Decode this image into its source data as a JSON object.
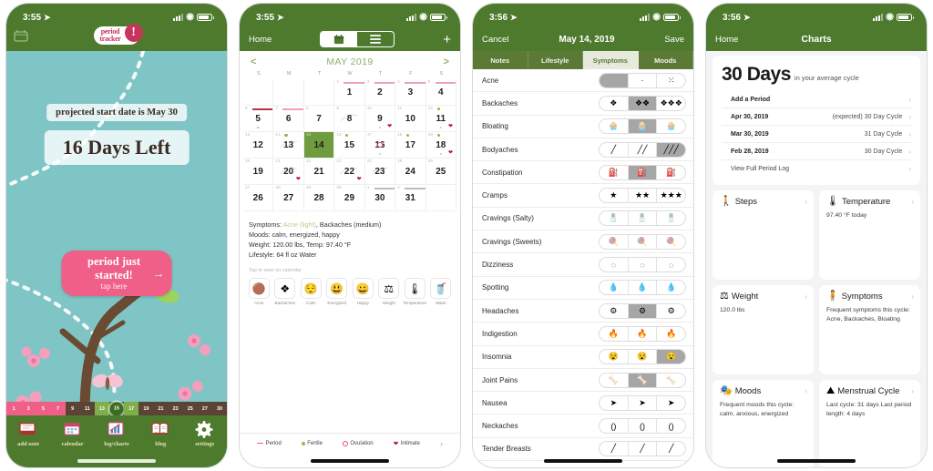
{
  "app": {
    "name": "Period Tracker",
    "brand_green": "#4e7a2e",
    "brand_pink": "#ef5f87",
    "brand_teal": "#7fc5c5",
    "brand_red": "#c8345c"
  },
  "panel1": {
    "status": {
      "time": "3:55",
      "location_icon": "location-arrow-icon"
    },
    "logo": {
      "line1": "period",
      "line2": "tracker",
      "bang": "!"
    },
    "projected_text": "projected start date is May 30",
    "days_left": "16 Days Left",
    "cta": {
      "title": "period just started!",
      "subtitle": "tap here",
      "arrow": "→"
    },
    "daystrip": [
      {
        "n": "1",
        "type": "period"
      },
      {
        "n": "3",
        "type": "period"
      },
      {
        "n": "5",
        "type": "period"
      },
      {
        "n": "7",
        "type": "period"
      },
      {
        "n": "9",
        "type": "normal"
      },
      {
        "n": "11",
        "type": "normal"
      },
      {
        "n": "13",
        "type": "fertile"
      },
      {
        "n": "15",
        "type": "today"
      },
      {
        "n": "17",
        "type": "fertile"
      },
      {
        "n": "19",
        "type": "normal"
      },
      {
        "n": "21",
        "type": "normal"
      },
      {
        "n": "23",
        "type": "normal"
      },
      {
        "n": "25",
        "type": "normal"
      },
      {
        "n": "27",
        "type": "normal"
      },
      {
        "n": "30",
        "type": "normal"
      }
    ],
    "tabs": [
      {
        "label": "add note",
        "icon": "note-icon"
      },
      {
        "label": "calendar",
        "icon": "calendar-icon"
      },
      {
        "label": "log/charts",
        "icon": "bar-chart-icon"
      },
      {
        "label": "blog",
        "icon": "book-icon"
      },
      {
        "label": "settings",
        "icon": "gear-icon"
      }
    ]
  },
  "panel2": {
    "status": {
      "time": "3:55"
    },
    "nav": {
      "home": "Home",
      "add": "+",
      "view_calendar_icon": "calendar-icon",
      "view_list_icon": "list-icon"
    },
    "calendar": {
      "prev": "<",
      "next": ">",
      "month": "MAY 2019",
      "dow": [
        "S",
        "M",
        "T",
        "W",
        "T",
        "F",
        "S"
      ],
      "weeks": [
        [
          {
            "day": "",
            "cycle": "",
            "blank": true
          },
          {
            "day": "",
            "cycle": "",
            "blank": true
          },
          {
            "day": "",
            "cycle": "",
            "blank": true
          },
          {
            "day": "1",
            "cycle": "2",
            "period": "light"
          },
          {
            "day": "2",
            "cycle": "3",
            "period": "light"
          },
          {
            "day": "3",
            "cycle": "4",
            "period": "light"
          },
          {
            "day": "4",
            "cycle": "5",
            "period": "light"
          }
        ],
        [
          {
            "day": "5",
            "cycle": "6",
            "period": "heavy",
            "dot": true
          },
          {
            "day": "6",
            "cycle": "7",
            "period": "light"
          },
          {
            "day": "7",
            "cycle": "8"
          },
          {
            "day": "8",
            "cycle": "9",
            "scribble": true
          },
          {
            "day": "9",
            "cycle": "10",
            "heart": true,
            "dot": true
          },
          {
            "day": "10",
            "cycle": "11"
          },
          {
            "day": "11",
            "cycle": "12",
            "fertile": true,
            "heart": true,
            "dot": true
          }
        ],
        [
          {
            "day": "12",
            "cycle": "13"
          },
          {
            "day": "13",
            "cycle": "14",
            "fertile": true,
            "scribble": true
          },
          {
            "day": "14",
            "cycle": "15",
            "selected": true
          },
          {
            "day": "15",
            "cycle": "16",
            "fertile": true
          },
          {
            "day": "16",
            "cycle": "17",
            "ovulation": true,
            "dot": true
          },
          {
            "day": "17",
            "cycle": "18",
            "fertile": true
          },
          {
            "day": "18",
            "cycle": "19",
            "fertile": true,
            "heart": true,
            "dot": true
          }
        ],
        [
          {
            "day": "19",
            "cycle": "20"
          },
          {
            "day": "20",
            "cycle": "21",
            "heart": true,
            "scribble": true
          },
          {
            "day": "21",
            "cycle": "22"
          },
          {
            "day": "22",
            "cycle": "23",
            "heart": true,
            "scribble": true
          },
          {
            "day": "23",
            "cycle": "24",
            "scribble": true
          },
          {
            "day": "24",
            "cycle": "25"
          },
          {
            "day": "25",
            "cycle": "26"
          }
        ],
        [
          {
            "day": "26",
            "cycle": "27"
          },
          {
            "day": "27",
            "cycle": "28"
          },
          {
            "day": "28",
            "cycle": "29"
          },
          {
            "day": "29",
            "cycle": "30"
          },
          {
            "day": "30",
            "cycle": "1",
            "predicted": true
          },
          {
            "day": "31",
            "cycle": "2",
            "predicted": true
          },
          {
            "day": "",
            "cycle": "",
            "blank": true
          }
        ]
      ]
    },
    "summary": {
      "symptoms_label": "Symptoms:",
      "symptoms_first": "Acne (light)",
      "symptoms_rest": ", Backaches (medium)",
      "moods": "Moods:  calm, energized, happy",
      "weight": "Weight: 120.00 lbs,  Temp: 97.40 °F",
      "lifestyle": "Lifestyle: 64 fl oz Water",
      "tap_hint": "Tap to view on calendar"
    },
    "quick_icons": [
      {
        "label": "Acne",
        "glyph": "🟤",
        "name": "acne-icon"
      },
      {
        "label": "Backaches",
        "glyph": "❖",
        "name": "backaches-icon"
      },
      {
        "label": "Calm",
        "glyph": "😌",
        "name": "calm-icon"
      },
      {
        "label": "Energized",
        "glyph": "😃",
        "name": "energized-icon"
      },
      {
        "label": "Happy",
        "glyph": "😀",
        "name": "happy-icon"
      },
      {
        "label": "Weight",
        "glyph": "⚖",
        "name": "weight-icon"
      },
      {
        "label": "Temperature",
        "glyph": "🌡",
        "name": "temperature-icon"
      },
      {
        "label": "Water",
        "glyph": "🥤",
        "name": "water-icon"
      }
    ],
    "legend": [
      {
        "label": "Period",
        "swatch": "line"
      },
      {
        "label": "Fertile",
        "swatch": "dot"
      },
      {
        "label": "Ovulation",
        "swatch": "ovu"
      },
      {
        "label": "Intimate",
        "swatch": "heart"
      }
    ],
    "legend_more": "›"
  },
  "panel3": {
    "status": {
      "time": "3:56"
    },
    "nav": {
      "cancel": "Cancel",
      "title": "May 14, 2019",
      "save": "Save"
    },
    "tabs": [
      {
        "label": "Notes",
        "active": false
      },
      {
        "label": "Lifestyle",
        "active": false
      },
      {
        "label": "Symptoms",
        "active": true
      },
      {
        "label": "Moods",
        "active": false
      }
    ],
    "symptoms": [
      {
        "name": "Acne",
        "selected": 1,
        "glyphs": [
          "",
          "·⁣",
          "⁙"
        ]
      },
      {
        "name": "Backaches",
        "selected": 2,
        "glyphs": [
          "❖",
          "❖❖",
          "❖❖❖"
        ]
      },
      {
        "name": "Bloating",
        "selected": 2,
        "glyphs": [
          "🧁",
          "🧁",
          "🧁"
        ]
      },
      {
        "name": "Bodyaches",
        "selected": 3,
        "glyphs": [
          "╱",
          "╱╱",
          "╱╱╱"
        ]
      },
      {
        "name": "Constipation",
        "selected": 2,
        "glyphs": [
          "⛽",
          "⛽",
          "⛽"
        ]
      },
      {
        "name": "Cramps",
        "selected": 0,
        "glyphs": [
          "★",
          "★★",
          "★★★"
        ]
      },
      {
        "name": "Cravings (Salty)",
        "selected": 0,
        "glyphs": [
          "🧂",
          "🧂",
          "🧂"
        ]
      },
      {
        "name": "Cravings (Sweets)",
        "selected": 0,
        "glyphs": [
          "🍭",
          "🍭",
          "🍭"
        ]
      },
      {
        "name": "Dizziness",
        "selected": 0,
        "glyphs": [
          "◌",
          "◌",
          "◌"
        ]
      },
      {
        "name": "Spotting",
        "selected": 0,
        "glyphs": [
          "💧",
          "💧",
          "💧"
        ]
      },
      {
        "name": "Headaches",
        "selected": 2,
        "glyphs": [
          "⚙",
          "⚙",
          "⚙"
        ]
      },
      {
        "name": "Indigestion",
        "selected": 0,
        "glyphs": [
          "🔥",
          "🔥",
          "🔥"
        ]
      },
      {
        "name": "Insomnia",
        "selected": 3,
        "glyphs": [
          "😵",
          "😵",
          "😵"
        ]
      },
      {
        "name": "Joint Pains",
        "selected": 2,
        "glyphs": [
          "🦴",
          "🦴",
          "🦴"
        ]
      },
      {
        "name": "Nausea",
        "selected": 0,
        "glyphs": [
          "➤",
          "➤",
          "➤"
        ]
      },
      {
        "name": "Neckaches",
        "selected": 0,
        "glyphs": [
          "()",
          "()",
          "()"
        ]
      },
      {
        "name": "Tender Breasts",
        "selected": 0,
        "glyphs": [
          "╱",
          "╱",
          "╱"
        ]
      }
    ]
  },
  "panel4": {
    "status": {
      "time": "3:56"
    },
    "nav": {
      "home": "Home",
      "title": "Charts"
    },
    "cycle_card": {
      "big_number": "30 Days",
      "big_caption": "in your average cycle",
      "rows": [
        {
          "left": "Add a Period",
          "right": "",
          "bold": true
        },
        {
          "left": "Apr 30, 2019",
          "right": "(expected) 30 Day Cycle",
          "bold": true
        },
        {
          "left": "Mar 30, 2019",
          "right": "31 Day Cycle",
          "bold": true
        },
        {
          "left": "Feb 28, 2019",
          "right": "30 Day Cycle",
          "bold": true
        },
        {
          "left": "View Full Period Log",
          "right": "",
          "bold": false
        }
      ],
      "chevron": "›"
    },
    "cards": [
      {
        "title": "Steps",
        "icon": "🚶",
        "icon_name": "steps-icon",
        "sub": ""
      },
      {
        "title": "Temperature",
        "icon": "🌡",
        "icon_name": "thermometer-icon",
        "sub": "97.40 °F today"
      },
      {
        "title": "Weight",
        "icon": "⚖",
        "icon_name": "scale-icon",
        "sub": "120.0 lbs"
      },
      {
        "title": "Symptoms",
        "icon": "🧍",
        "icon_name": "symptoms-icon",
        "sub": "Frequent symptoms this cycle: Acne, Backaches, Bloating"
      },
      {
        "title": "Moods",
        "icon": "🎭",
        "icon_name": "moods-icon",
        "sub": "Frequent moods this cycle: calm, anxious, energized"
      },
      {
        "title": "Menstrual Cycle",
        "icon": "⛰",
        "icon_name": "menstrual-cycle-icon",
        "sub": "Last cycle: 31 days\nLast period length:\n4 days"
      }
    ],
    "chevron": "›"
  }
}
